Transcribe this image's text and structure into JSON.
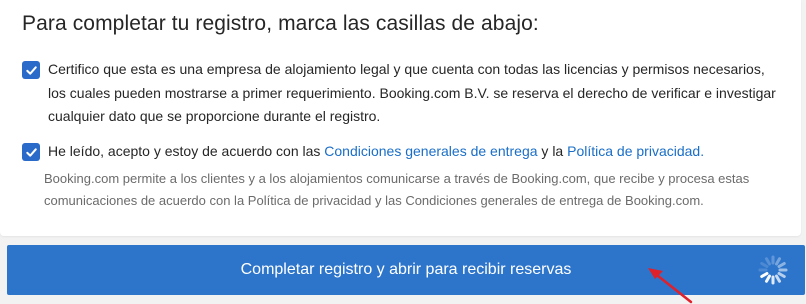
{
  "heading": "Para completar tu registro, marca las casillas de abajo:",
  "checkboxes": {
    "legal": {
      "checked": true,
      "text": "Certifico que esta es una empresa de alojamiento legal y que cuenta con todas las licencias y permisos necesarios, los cuales pueden mostrarse a primer requerimiento. Booking.com B.V. se reserva el derecho de verificar e investigar cualquier dato que se proporcione durante el registro."
    },
    "terms": {
      "checked": true,
      "text_before": "He leído, acepto y estoy de acuerdo con las ",
      "link_terms": "Condiciones generales de entrega",
      "text_middle": " y la ",
      "link_privacy": "Política de privacidad."
    }
  },
  "note": "Booking.com permite a los clientes y a los alojamientos comunicarse a través de Booking.com, que recibe y procesa estas comunicaciones de acuerdo con la Política de privacidad y las Condiciones generales de entrega de Booking.com.",
  "cta": {
    "label": "Completar registro y abrir para recibir reservas",
    "state": "loading"
  },
  "icons": {
    "checkbox": "checkmark-icon",
    "spinner": "loading-spinner-icon",
    "annotation": "red-arrow-icon"
  },
  "colors": {
    "accent": "#2d75cb",
    "checkbox": "#2a6ac8",
    "link": "#1a6ec7",
    "annotation": "#e0202a"
  }
}
